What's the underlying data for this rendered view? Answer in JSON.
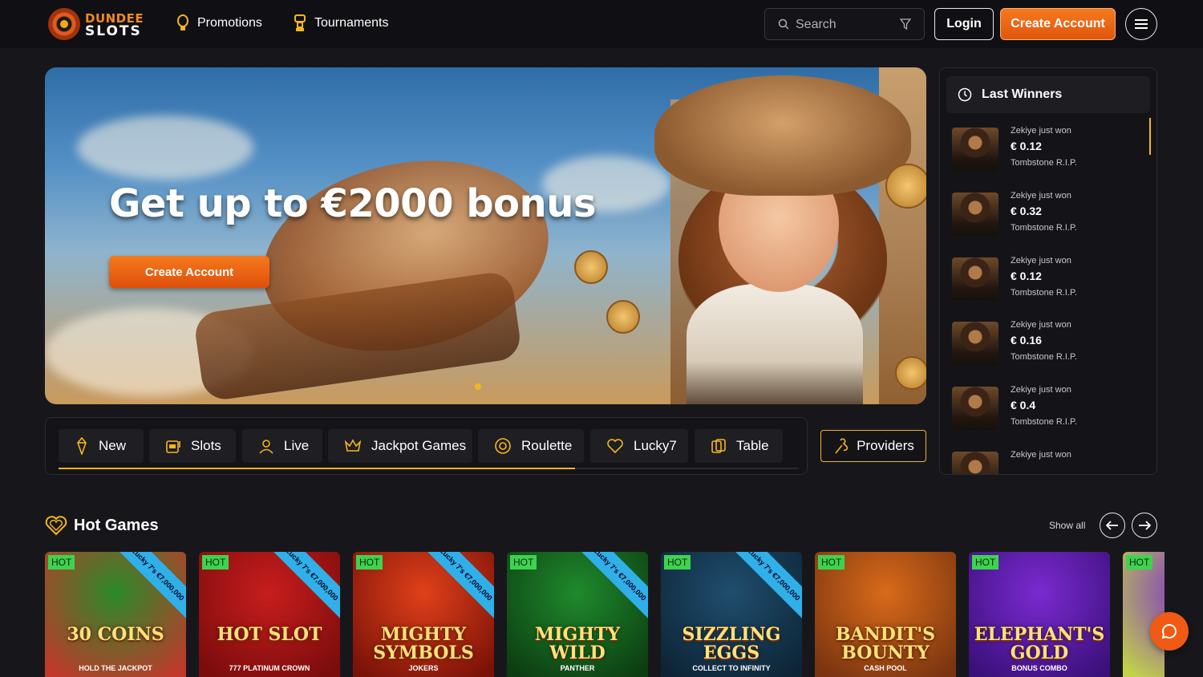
{
  "brand": {
    "logo_top": "DUNDEE",
    "logo_bottom": "SLOTS"
  },
  "nav": [
    {
      "label": "Promotions",
      "icon": "lightbulb-icon"
    },
    {
      "label": "Tournaments",
      "icon": "trophy-icon"
    }
  ],
  "search": {
    "placeholder": "Search"
  },
  "header": {
    "login_label": "Login",
    "create_label": "Create Account"
  },
  "hero": {
    "title": "Get up to €2000 bonus",
    "cta_label": "Create Account"
  },
  "winners": {
    "title": "Last Winners",
    "items": [
      {
        "text": "Zekiye just won",
        "amount": "€ 0.12",
        "game": "Tombstone R.I.P."
      },
      {
        "text": "Zekiye just won",
        "amount": "€ 0.32",
        "game": "Tombstone R.I.P."
      },
      {
        "text": "Zekiye just won",
        "amount": "€ 0.12",
        "game": "Tombstone R.I.P."
      },
      {
        "text": "Zekiye just won",
        "amount": "€ 0.16",
        "game": "Tombstone R.I.P."
      },
      {
        "text": "Zekiye just won",
        "amount": "€ 0.4",
        "game": "Tombstone R.I.P."
      },
      {
        "text": "Zekiye just won",
        "amount": "",
        "game": ""
      }
    ]
  },
  "categories": [
    {
      "label": "New",
      "icon": "gem-icon"
    },
    {
      "label": "Slots",
      "icon": "slot-machine-icon"
    },
    {
      "label": "Live",
      "icon": "dealer-icon"
    },
    {
      "label": "Jackpot Games",
      "icon": "crown-icon"
    },
    {
      "label": "Roulette",
      "icon": "roulette-icon"
    },
    {
      "label": "Lucky7",
      "icon": "heart-icon"
    },
    {
      "label": "Table",
      "icon": "cards-icon"
    }
  ],
  "providers_label": "Providers",
  "hot_games": {
    "title": "Hot Games",
    "show_all": "Show all",
    "badge": "HOT",
    "ribbon": "Lucky 7's €7,000,000",
    "games": [
      {
        "name": "30 COINS",
        "sub": "HOLD THE JACKPOT",
        "ribbon": true,
        "colors": [
          "#2a8a2a",
          "#c0392b"
        ]
      },
      {
        "name": "HOT SLOT",
        "sub": "777 PLATINUM CROWN",
        "ribbon": true,
        "colors": [
          "#c81d1d",
          "#7a0c0c"
        ]
      },
      {
        "name": "MIGHTY SYMBOLS",
        "sub": "JOKERS",
        "ribbon": true,
        "colors": [
          "#e0401a",
          "#7a1208"
        ]
      },
      {
        "name": "MIGHTY WILD",
        "sub": "PANTHER",
        "ribbon": true,
        "colors": [
          "#1f8a2c",
          "#0c3d12"
        ]
      },
      {
        "name": "SIZZLING EGGS",
        "sub": "COLLECT TO INFINITY",
        "ribbon": true,
        "colors": [
          "#1f4e6e",
          "#0d2436"
        ]
      },
      {
        "name": "BANDIT'S BOUNTY",
        "sub": "CASH POOL",
        "ribbon": false,
        "colors": [
          "#d86a1a",
          "#7a3410"
        ]
      },
      {
        "name": "ELEPHANT'S GOLD",
        "sub": "BONUS COMBO",
        "ribbon": false,
        "colors": [
          "#7a2ad0",
          "#3a107a"
        ]
      },
      {
        "name": "",
        "sub": "",
        "ribbon": false,
        "colors": [
          "#7a2ad0",
          "#c2d04a"
        ]
      }
    ]
  }
}
